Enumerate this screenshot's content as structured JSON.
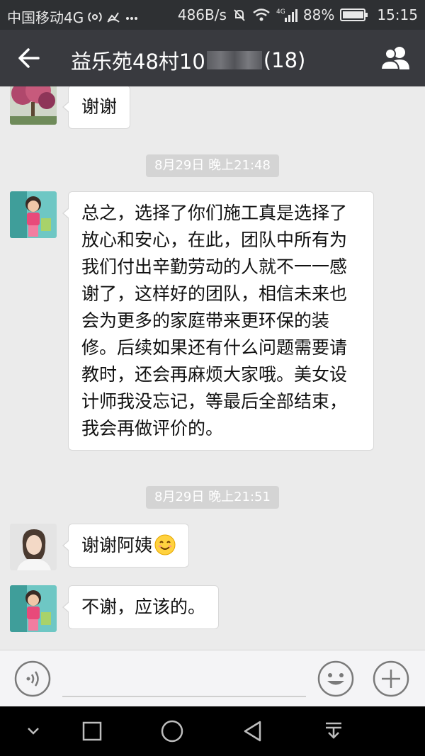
{
  "status_bar": {
    "carrier": "中国移动4G",
    "net_speed": "486B/s",
    "net_type": "4G",
    "battery": "88%",
    "battery_level": 0.88,
    "time": "15:15"
  },
  "header": {
    "title_prefix": "益乐苑48村10",
    "member_count": "(18)",
    "back_icon": "arrow-left-icon",
    "group_icon": "group-members-icon"
  },
  "messages": [
    {
      "type": "text",
      "text": "谢谢",
      "avatar": "tree-avatar"
    },
    {
      "type": "time",
      "text": "8月29日 晚上21:48"
    },
    {
      "type": "text",
      "lines": [
        "总之，选择了你们施工真是选择了",
        "放心和安心，在此，团队中所有为",
        "我们付出辛勤劳动的人就不一一感",
        "谢了，这样好的团队，相信未来也",
        "会为更多的家庭带来更环保的装",
        "修。后续如果还有什么问题需要请",
        "教时，还会再麻烦大家哦。美女设",
        "计师我没忘记，等最后全部结束，",
        "我会再做评价的。"
      ],
      "avatar": "child-avatar"
    },
    {
      "type": "time",
      "text": "8月29日 晚上21:51"
    },
    {
      "type": "text",
      "text": "谢谢阿姨",
      "emoji": "smiling-face",
      "avatar": "woman-avatar"
    },
    {
      "type": "text",
      "text": "不谢，应该的。",
      "avatar": "child-avatar"
    }
  ],
  "input_bar": {
    "voice_icon": "voice-icon",
    "text_value": "",
    "emoji_icon": "emoji-icon",
    "plus_icon": "plus-icon"
  },
  "nav_bar": {
    "icons": [
      "chevron-down-icon",
      "square-icon",
      "circle-icon",
      "triangle-back-icon",
      "notification-pull-icon"
    ]
  },
  "colors": {
    "status_bar_bg": "#2e3033",
    "title_bar_bg": "#393a3f",
    "chat_bg": "#ebebeb",
    "bubble_bg": "#ffffff",
    "time_badge_bg": "#d4d4d4"
  }
}
